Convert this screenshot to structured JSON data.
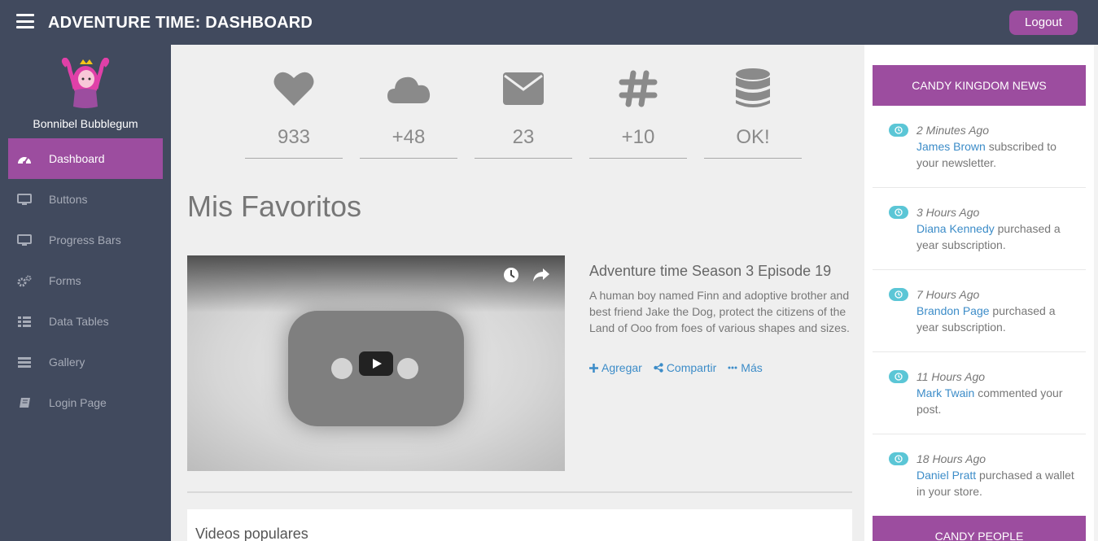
{
  "header": {
    "title": "ADVENTURE TIME: DASHBOARD",
    "logout_label": "Logout"
  },
  "sidebar": {
    "user_name": "Bonnibel Bubblegum",
    "items": [
      {
        "label": "Dashboard",
        "icon": "dashboard-icon",
        "active": true
      },
      {
        "label": "Buttons",
        "icon": "desktop-icon"
      },
      {
        "label": "Progress Bars",
        "icon": "desktop-icon"
      },
      {
        "label": "Forms",
        "icon": "gears-icon"
      },
      {
        "label": "Data Tables",
        "icon": "table-icon"
      },
      {
        "label": "Gallery",
        "icon": "gallery-icon"
      },
      {
        "label": "Login Page",
        "icon": "book-icon"
      }
    ]
  },
  "stats": [
    {
      "icon": "heart-icon",
      "value": "933"
    },
    {
      "icon": "cloud-icon",
      "value": "+48"
    },
    {
      "icon": "envelope-icon",
      "value": "23"
    },
    {
      "icon": "hashtag-icon",
      "value": "+10"
    },
    {
      "icon": "database-icon",
      "value": "OK!"
    }
  ],
  "favorites": {
    "title": "Mis Favoritos",
    "episode_title": "Adventure time Season 3 Episode 19",
    "description": "A human boy named Finn and adoptive brother and best friend Jake the Dog, protect the citizens of the Land of Ooo from foes of various shapes and sizes.",
    "actions": {
      "add": "Agregar",
      "share": "Compartir",
      "more": "Más"
    }
  },
  "popular": {
    "title": "Videos populares"
  },
  "news": {
    "title": "CANDY KINGDOM NEWS",
    "items": [
      {
        "time": "2 Minutes Ago",
        "name": "James Brown",
        "text": " subscribed to your newsletter."
      },
      {
        "time": "3 Hours Ago",
        "name": "Diana Kennedy",
        "text": " purchased a year subscription."
      },
      {
        "time": "7 Hours Ago",
        "name": "Brandon Page",
        "text": " purchased a year subscription."
      },
      {
        "time": "11 Hours Ago",
        "name": "Mark Twain",
        "text": " commented your post."
      },
      {
        "time": "18 Hours Ago",
        "name": "Daniel Pratt",
        "text": " purchased a wallet in your store."
      }
    ]
  },
  "people": {
    "title": "CANDY PEOPLE"
  },
  "colors": {
    "topbar": "#414a5e",
    "accent": "#9c4d9f",
    "link": "#3c8cc8",
    "badge": "#5bc6d6"
  }
}
